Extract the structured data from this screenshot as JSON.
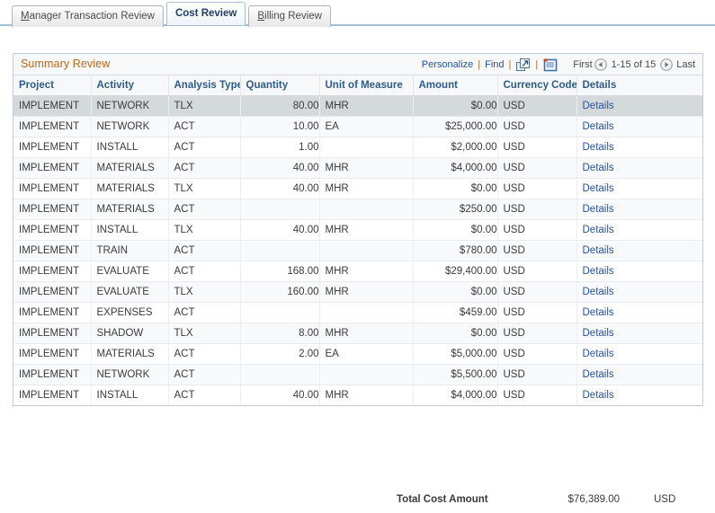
{
  "tabs": [
    {
      "label": "Manager Transaction Review",
      "accesskey": "M",
      "active": false
    },
    {
      "label": "Cost Review",
      "accesskey": "",
      "active": true
    },
    {
      "label": "Billing Review",
      "accesskey": "B",
      "active": false
    }
  ],
  "panel": {
    "title": "Summary Review",
    "toolbar": {
      "personalize": "Personalize",
      "find": "Find",
      "separator": "|",
      "expand_icon": "expand-window-icon",
      "spreadsheet_icon": "download-spreadsheet-icon"
    },
    "pager": {
      "first": "First",
      "prev_icon": "previous-page-icon",
      "count": "1-15 of 15",
      "next_icon": "next-page-icon",
      "last": "Last"
    },
    "columns": [
      "Project",
      "Activity",
      "Analysis Type",
      "Quantity",
      "Unit of Measure",
      "Amount",
      "Currency Code",
      "Details"
    ],
    "rows": [
      {
        "project": "IMPLEMENT",
        "activity": "NETWORK",
        "analysis_type": "TLX",
        "quantity": "80.00",
        "uom": "MHR",
        "amount": "$0.00",
        "currency": "USD",
        "details": "Details",
        "selected": true
      },
      {
        "project": "IMPLEMENT",
        "activity": "NETWORK",
        "analysis_type": "ACT",
        "quantity": "10.00",
        "uom": "EA",
        "amount": "$25,000.00",
        "currency": "USD",
        "details": "Details",
        "selected": false
      },
      {
        "project": "IMPLEMENT",
        "activity": "INSTALL",
        "analysis_type": "ACT",
        "quantity": "1.00",
        "uom": "",
        "amount": "$2,000.00",
        "currency": "USD",
        "details": "Details",
        "selected": false
      },
      {
        "project": "IMPLEMENT",
        "activity": "MATERIALS",
        "analysis_type": "ACT",
        "quantity": "40.00",
        "uom": "MHR",
        "amount": "$4,000.00",
        "currency": "USD",
        "details": "Details",
        "selected": false
      },
      {
        "project": "IMPLEMENT",
        "activity": "MATERIALS",
        "analysis_type": "TLX",
        "quantity": "40.00",
        "uom": "MHR",
        "amount": "$0.00",
        "currency": "USD",
        "details": "Details",
        "selected": false
      },
      {
        "project": "IMPLEMENT",
        "activity": "MATERIALS",
        "analysis_type": "ACT",
        "quantity": "",
        "uom": "",
        "amount": "$250.00",
        "currency": "USD",
        "details": "Details",
        "selected": false
      },
      {
        "project": "IMPLEMENT",
        "activity": "INSTALL",
        "analysis_type": "TLX",
        "quantity": "40.00",
        "uom": "MHR",
        "amount": "$0.00",
        "currency": "USD",
        "details": "Details",
        "selected": false
      },
      {
        "project": "IMPLEMENT",
        "activity": "TRAIN",
        "analysis_type": "ACT",
        "quantity": "",
        "uom": "",
        "amount": "$780.00",
        "currency": "USD",
        "details": "Details",
        "selected": false
      },
      {
        "project": "IMPLEMENT",
        "activity": "EVALUATE",
        "analysis_type": "ACT",
        "quantity": "168.00",
        "uom": "MHR",
        "amount": "$29,400.00",
        "currency": "USD",
        "details": "Details",
        "selected": false
      },
      {
        "project": "IMPLEMENT",
        "activity": "EVALUATE",
        "analysis_type": "TLX",
        "quantity": "160.00",
        "uom": "MHR",
        "amount": "$0.00",
        "currency": "USD",
        "details": "Details",
        "selected": false
      },
      {
        "project": "IMPLEMENT",
        "activity": "EXPENSES",
        "analysis_type": "ACT",
        "quantity": "",
        "uom": "",
        "amount": "$459.00",
        "currency": "USD",
        "details": "Details",
        "selected": false
      },
      {
        "project": "IMPLEMENT",
        "activity": "SHADOW",
        "analysis_type": "TLX",
        "quantity": "8.00",
        "uom": "MHR",
        "amount": "$0.00",
        "currency": "USD",
        "details": "Details",
        "selected": false
      },
      {
        "project": "IMPLEMENT",
        "activity": "MATERIALS",
        "analysis_type": "ACT",
        "quantity": "2.00",
        "uom": "EA",
        "amount": "$5,000.00",
        "currency": "USD",
        "details": "Details",
        "selected": false
      },
      {
        "project": "IMPLEMENT",
        "activity": "NETWORK",
        "analysis_type": "ACT",
        "quantity": "",
        "uom": "",
        "amount": "$5,500.00",
        "currency": "USD",
        "details": "Details",
        "selected": false
      },
      {
        "project": "IMPLEMENT",
        "activity": "INSTALL",
        "analysis_type": "ACT",
        "quantity": "40.00",
        "uom": "MHR",
        "amount": "$4,000.00",
        "currency": "USD",
        "details": "Details",
        "selected": false
      }
    ]
  },
  "totals": {
    "label": "Total Cost Amount",
    "amount": "$76,389.00",
    "currency": "USD"
  },
  "colors": {
    "panel_title": "#c06316",
    "link": "#2554a0",
    "header_text": "#2e5c8a",
    "selected_row": "#d3dad9"
  }
}
